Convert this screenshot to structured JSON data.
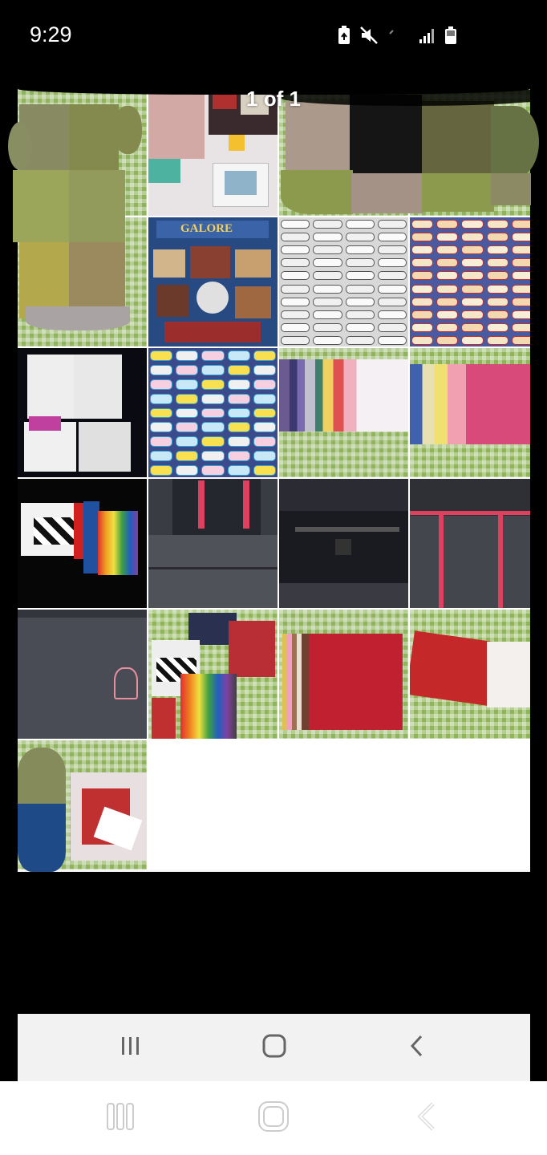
{
  "status_bar": {
    "time": "9:29",
    "icons": [
      "recycle-battery-icon",
      "mute-icon",
      "signal-icon",
      "battery-icon"
    ]
  },
  "viewer": {
    "counter": "1 of 1"
  },
  "photos": [
    {
      "name": "photo-1",
      "theme": "censored"
    },
    {
      "name": "photo-2",
      "theme": "supplies-on-gingham"
    },
    {
      "name": "photo-3",
      "theme": "censored"
    },
    {
      "name": "photo-4",
      "theme": "censored"
    },
    {
      "name": "photo-5",
      "theme": "censored"
    },
    {
      "name": "photo-6",
      "theme": "galore-package"
    },
    {
      "name": "photo-7",
      "theme": "sticker-sheet-white"
    },
    {
      "name": "photo-8",
      "theme": "sticker-sheet-color"
    },
    {
      "name": "photo-9",
      "theme": "alphabet-stickers"
    },
    {
      "name": "photo-10",
      "theme": "sticker-sheets-bright"
    },
    {
      "name": "photo-11",
      "theme": "paper-stack-pastel"
    },
    {
      "name": "photo-12",
      "theme": "paper-stack-pink"
    },
    {
      "name": "photo-13",
      "theme": "paper-packs"
    },
    {
      "name": "photo-14",
      "theme": "bag-straps"
    },
    {
      "name": "photo-15",
      "theme": "bag-open"
    },
    {
      "name": "photo-16",
      "theme": "bag-pockets"
    },
    {
      "name": "photo-17",
      "theme": "bag-front"
    },
    {
      "name": "photo-18",
      "theme": "supplies-pile"
    },
    {
      "name": "photo-19",
      "theme": "paper-red"
    },
    {
      "name": "photo-20",
      "theme": "paper-red-spread"
    },
    {
      "name": "photo-21",
      "theme": "censored-paper"
    }
  ],
  "nav": {
    "inner": {
      "recent": "recent-apps-icon",
      "home": "home-icon",
      "back": "back-icon"
    },
    "outer": {
      "recent": "recent-apps-icon",
      "home": "home-icon",
      "back": "back-icon"
    }
  },
  "colors": {
    "background": "#000000",
    "sheet": "#f7f7f7",
    "gingham": "#8fb45a"
  }
}
